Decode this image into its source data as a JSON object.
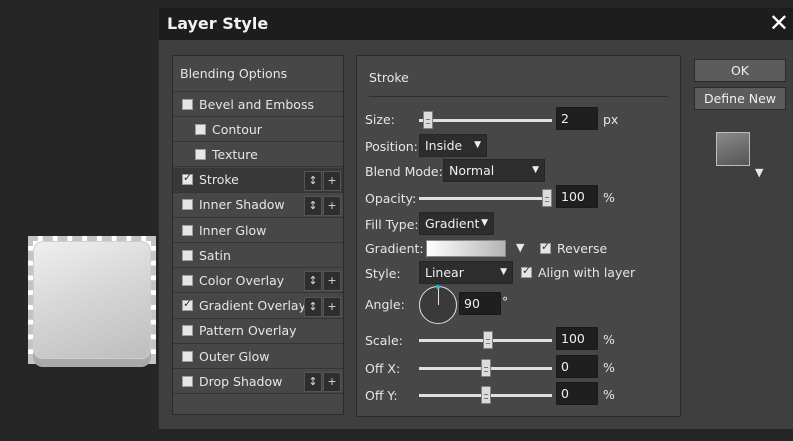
{
  "canvas": {
    "layer_preview": "layer-thumbnail"
  },
  "dialog": {
    "title": "Layer Style",
    "close_icon": "close-icon"
  },
  "list": {
    "header": "Blending Options",
    "items": [
      {
        "label": "Bevel and Emboss",
        "checked": false,
        "indent": false,
        "buttons": false,
        "selected": false
      },
      {
        "label": "Contour",
        "checked": false,
        "indent": true,
        "buttons": false,
        "selected": false
      },
      {
        "label": "Texture",
        "checked": false,
        "indent": true,
        "buttons": false,
        "selected": false
      },
      {
        "label": "Stroke",
        "checked": true,
        "indent": false,
        "buttons": true,
        "selected": true
      },
      {
        "label": "Inner Shadow",
        "checked": false,
        "indent": false,
        "buttons": true,
        "selected": false
      },
      {
        "label": "Inner Glow",
        "checked": false,
        "indent": false,
        "buttons": false,
        "selected": false
      },
      {
        "label": "Satin",
        "checked": false,
        "indent": false,
        "buttons": false,
        "selected": false
      },
      {
        "label": "Color Overlay",
        "checked": false,
        "indent": false,
        "buttons": true,
        "selected": false
      },
      {
        "label": "Gradient Overlay",
        "checked": true,
        "indent": false,
        "buttons": true,
        "selected": false
      },
      {
        "label": "Pattern Overlay",
        "checked": false,
        "indent": false,
        "buttons": false,
        "selected": false
      },
      {
        "label": "Outer Glow",
        "checked": false,
        "indent": false,
        "buttons": false,
        "selected": false
      },
      {
        "label": "Drop Shadow",
        "checked": false,
        "indent": false,
        "buttons": true,
        "selected": false
      }
    ],
    "reorder_glyph": "↕",
    "add_glyph": "+"
  },
  "stroke": {
    "section_title": "Stroke",
    "size": {
      "label": "Size:",
      "value": "2",
      "unit": "px",
      "level": 0.03
    },
    "position": {
      "label": "Position:",
      "value": "Inside"
    },
    "blend_mode": {
      "label": "Blend Mode:",
      "value": "Normal"
    },
    "opacity": {
      "label": "Opacity:",
      "value": "100",
      "unit": "%",
      "level": 1.0
    },
    "fill_type": {
      "label": "Fill Type:",
      "value": "Gradient"
    },
    "gradient": {
      "label": "Gradient:",
      "reverse_label": "Reverse",
      "reverse_checked": true
    },
    "style": {
      "label": "Style:",
      "value": "Linear",
      "align_label": "Align with layer",
      "align_checked": true
    },
    "angle": {
      "label": "Angle:",
      "value": "90",
      "unit": "°"
    },
    "scale": {
      "label": "Scale:",
      "value": "100",
      "unit": "%",
      "level": 0.52
    },
    "off_x": {
      "label": "Off X:",
      "value": "0",
      "unit": "%",
      "level": 0.5
    },
    "off_y": {
      "label": "Off Y:",
      "value": "0",
      "unit": "%",
      "level": 0.5
    }
  },
  "buttons": {
    "ok": "OK",
    "define_new": "Define New"
  },
  "colors": {
    "accent": "#26c0d6",
    "dialog_bg": "#3f3f3f",
    "titlebar": "#1d1d1d"
  }
}
